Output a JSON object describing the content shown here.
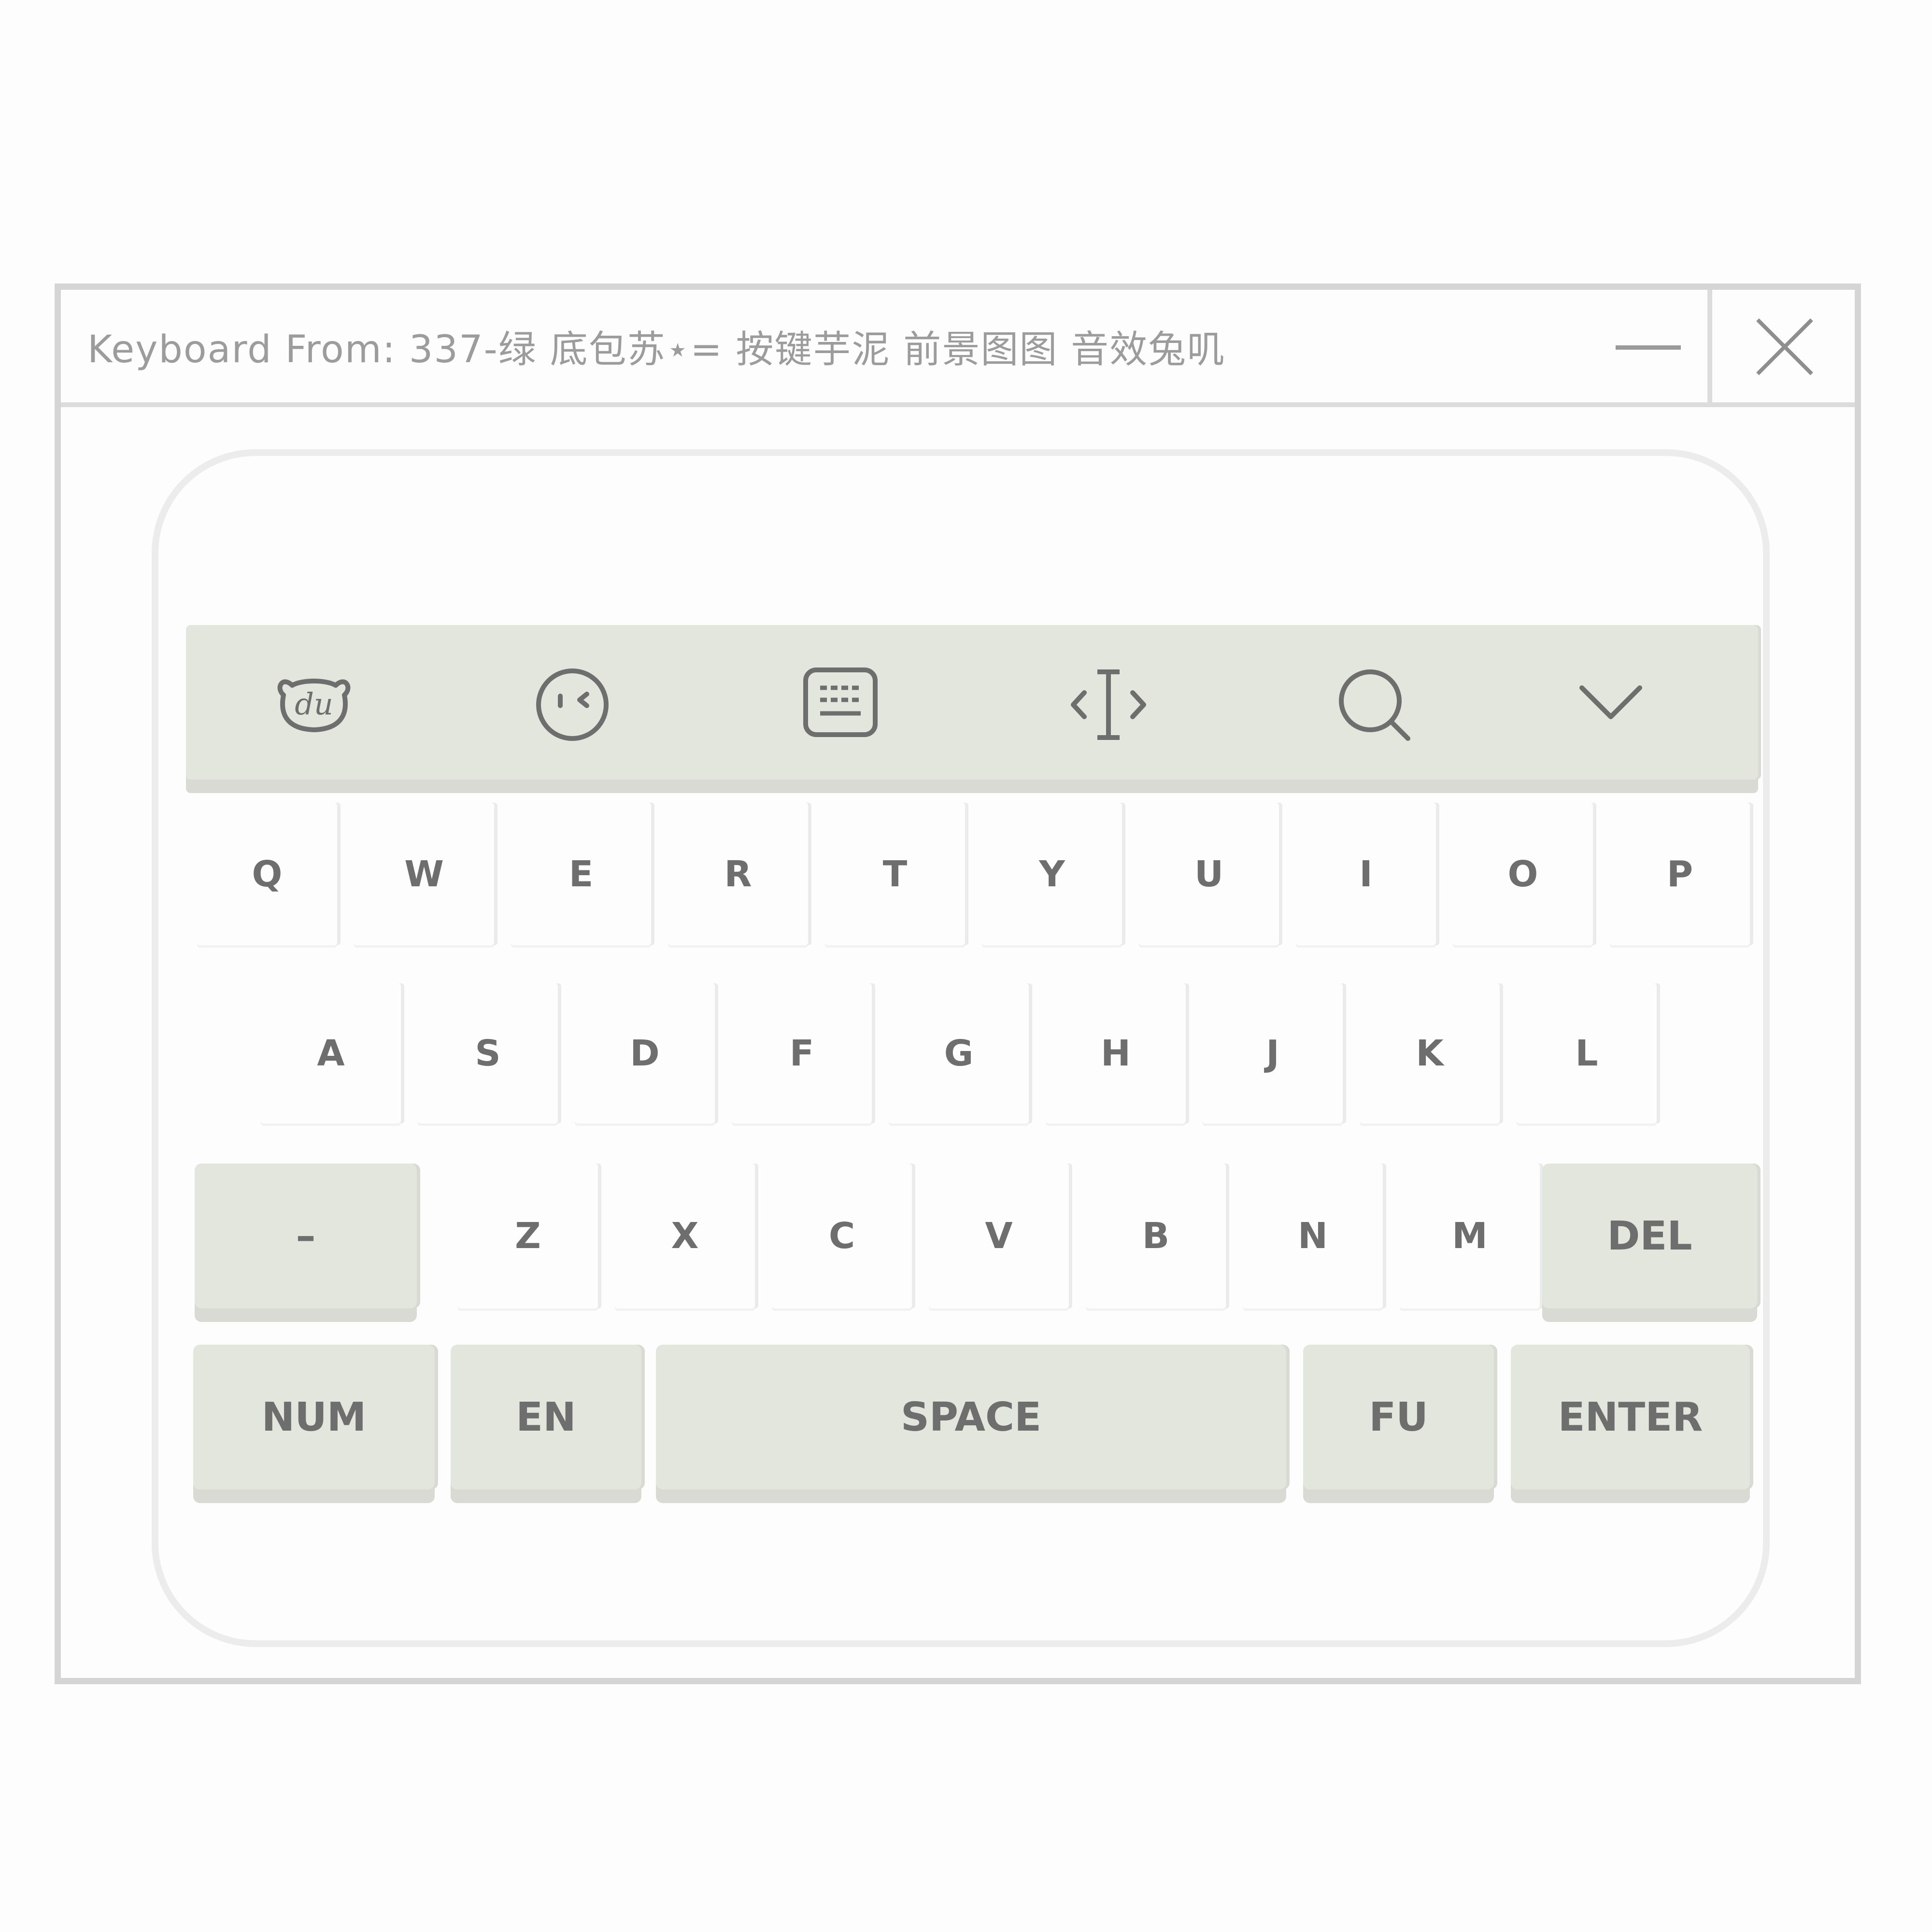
{
  "window": {
    "title": "Keyboard From: 337-绿 底包苏⋆= 按键芋泥 前景图图 音效兔叽"
  },
  "toolbar": {
    "icons": [
      "du-bear-icon",
      "emoji-wink-icon",
      "keyboard-icon",
      "cursor-move-icon",
      "search-icon",
      "chevron-down-icon"
    ]
  },
  "keys": {
    "row1": [
      "Q",
      "W",
      "E",
      "R",
      "T",
      "Y",
      "U",
      "I",
      "O",
      "P"
    ],
    "row2": [
      "A",
      "S",
      "D",
      "F",
      "G",
      "H",
      "J",
      "K",
      "L"
    ],
    "row3": [
      "Z",
      "X",
      "C",
      "V",
      "B",
      "N",
      "M"
    ],
    "dash": "–",
    "del": "DEL",
    "num": "NUM",
    "en": "EN",
    "space": "SPACE",
    "fu": "FU",
    "enter": "ENTER"
  },
  "colors": {
    "key_accent": "#e2e6dc",
    "key_text": "#6e6e6e",
    "border": "#d5d5d5"
  }
}
